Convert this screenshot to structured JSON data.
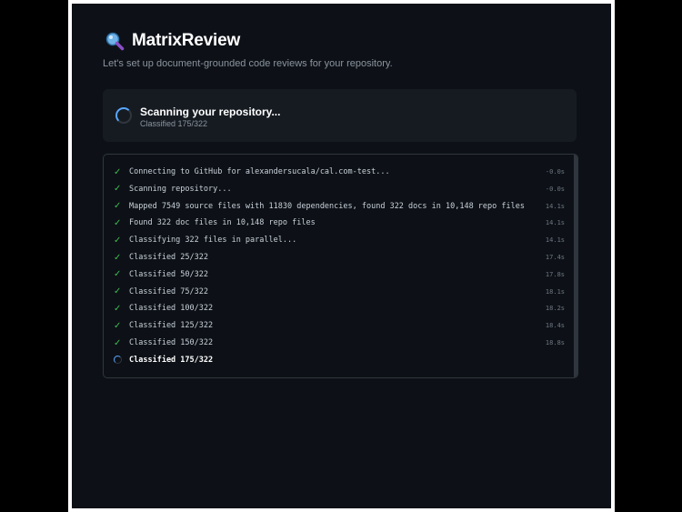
{
  "app": {
    "title": "MatrixReview",
    "subtitle": "Let's set up document-grounded code reviews for your repository."
  },
  "status": {
    "title": "Scanning your repository...",
    "progress_text": "Classified 175/322"
  },
  "log": [
    {
      "text": "Connecting to GitHub for alexandersucala/cal.com-test...",
      "time": "-0.0s",
      "state": "done"
    },
    {
      "text": "Scanning repository...",
      "time": "-0.0s",
      "state": "done"
    },
    {
      "text": "Mapped 7549 source files with 11830 dependencies, found 322 docs in 10,148 repo files",
      "time": "14.1s",
      "state": "done"
    },
    {
      "text": "Found 322 doc files in 10,148 repo files",
      "time": "14.1s",
      "state": "done"
    },
    {
      "text": "Classifying 322 files in parallel...",
      "time": "14.1s",
      "state": "done"
    },
    {
      "text": "Classified 25/322",
      "time": "17.4s",
      "state": "done"
    },
    {
      "text": "Classified 50/322",
      "time": "17.8s",
      "state": "done"
    },
    {
      "text": "Classified 75/322",
      "time": "18.1s",
      "state": "done"
    },
    {
      "text": "Classified 100/322",
      "time": "18.2s",
      "state": "done"
    },
    {
      "text": "Classified 125/322",
      "time": "18.4s",
      "state": "done"
    },
    {
      "text": "Classified 150/322",
      "time": "18.8s",
      "state": "done"
    },
    {
      "text": "Classified 175/322",
      "time": "",
      "state": "active"
    }
  ]
}
